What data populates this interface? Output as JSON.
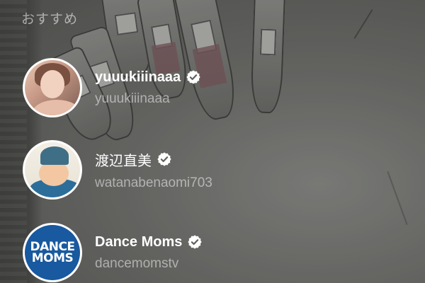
{
  "section_title": "おすすめ",
  "accounts": [
    {
      "name": "yuuukiiinaaa",
      "handle": "yuuukiiinaaa",
      "verified": true
    },
    {
      "name": "渡辺直美",
      "handle": "watanabenaomi703",
      "verified": true
    },
    {
      "name": "Dance Moms",
      "handle": "dancemomstv",
      "verified": true,
      "avatar_logo_lines": [
        "DANCE",
        "MOMS"
      ]
    }
  ],
  "icons": {
    "verified": "verified-badge-icon"
  },
  "colors": {
    "text_primary": "#ffffff",
    "text_secondary": "#bdbdbd",
    "logo_blue": "#18599f"
  }
}
